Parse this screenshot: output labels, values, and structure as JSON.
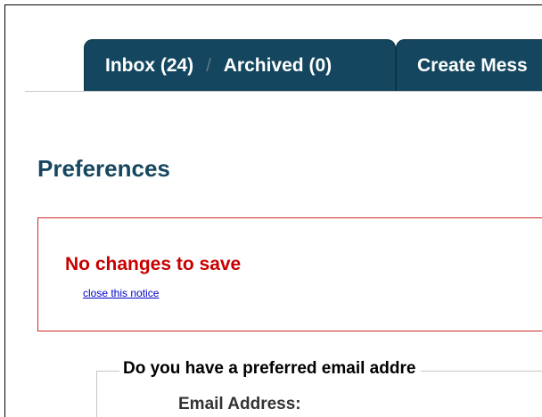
{
  "tabs": {
    "inbox_label": "Inbox (24)",
    "separator": "/",
    "archived_label": "Archived (0)",
    "create_label": "Create Mess"
  },
  "page": {
    "title": "Preferences"
  },
  "notice": {
    "message": "No changes to save",
    "close_link": "close this notice",
    "border_color": "#cf2a2a",
    "text_color": "#c80000"
  },
  "preferences_form": {
    "question": "Do you have a preferred email addre",
    "email_label": "Email Address:"
  },
  "colors": {
    "tab_background": "#14475f",
    "title_color": "#17475f",
    "link_color": "#0000cc"
  }
}
